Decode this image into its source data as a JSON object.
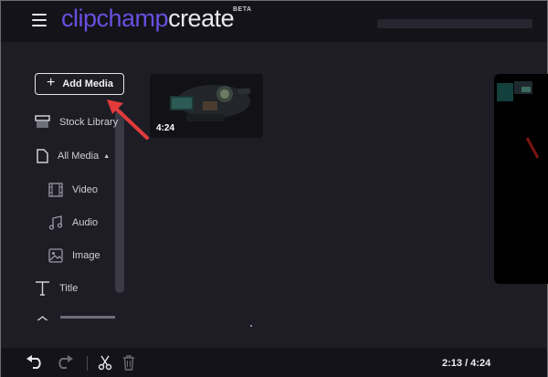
{
  "header": {
    "logo_brand": "clipchamp",
    "logo_product": "create",
    "beta_badge": "BETA"
  },
  "sidebar": {
    "add_media_label": "Add Media",
    "items": [
      {
        "label": "Stock Library",
        "icon": "box-icon"
      },
      {
        "label": "All Media",
        "icon": "file-icon",
        "expanded": true
      },
      {
        "label": "Video",
        "icon": "film-icon"
      },
      {
        "label": "Audio",
        "icon": "music-note-icon"
      },
      {
        "label": "Image",
        "icon": "image-icon"
      },
      {
        "label": "Title",
        "icon": "text-t-icon"
      }
    ]
  },
  "media": {
    "clips": [
      {
        "duration": "4:24"
      }
    ]
  },
  "footer": {
    "timecode": "2:13 / 4:24"
  },
  "colors": {
    "brand": "#6a4fe0",
    "annotation_arrow": "#e23b3b"
  }
}
